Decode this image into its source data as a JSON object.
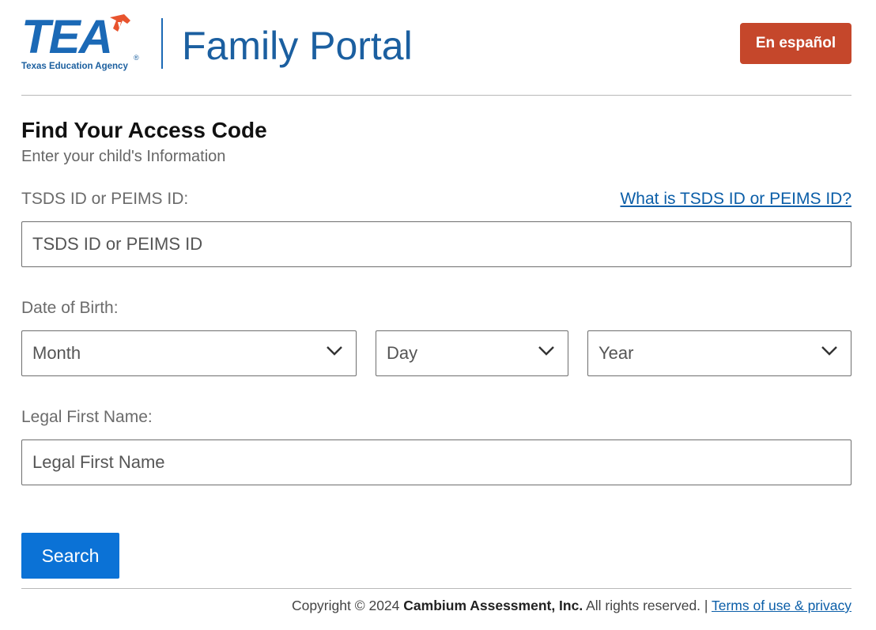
{
  "header": {
    "logo_text": "TEA",
    "logo_subtitle": "Texas Education Agency",
    "logo_registered": "®",
    "portal_title": "Family Portal",
    "language_button": "En español"
  },
  "form": {
    "heading": "Find Your Access Code",
    "subheading": "Enter your child's Information",
    "id_label": "TSDS ID or PEIMS ID:",
    "id_help_link": "What is TSDS ID or PEIMS ID?",
    "id_placeholder": "TSDS ID or PEIMS ID",
    "dob_label": "Date of Birth:",
    "month_placeholder": "Month",
    "day_placeholder": "Day",
    "year_placeholder": "Year",
    "first_name_label": "Legal First Name:",
    "first_name_placeholder": "Legal First Name",
    "search_button": "Search"
  },
  "footer": {
    "copyright_prefix": "Copyright © 2024",
    "company": "Cambium Assessment, Inc.",
    "rights": "All rights reserved. |",
    "terms_link": "Terms of use & privacy"
  },
  "icons": {
    "select_arrow": "chevron-down-icon",
    "logo_flag": "flag-icon"
  },
  "colors": {
    "brand_blue": "#1b69b6",
    "language_button": "#c5472b",
    "search_button": "#0b72d6",
    "link": "#0b5ea8"
  }
}
